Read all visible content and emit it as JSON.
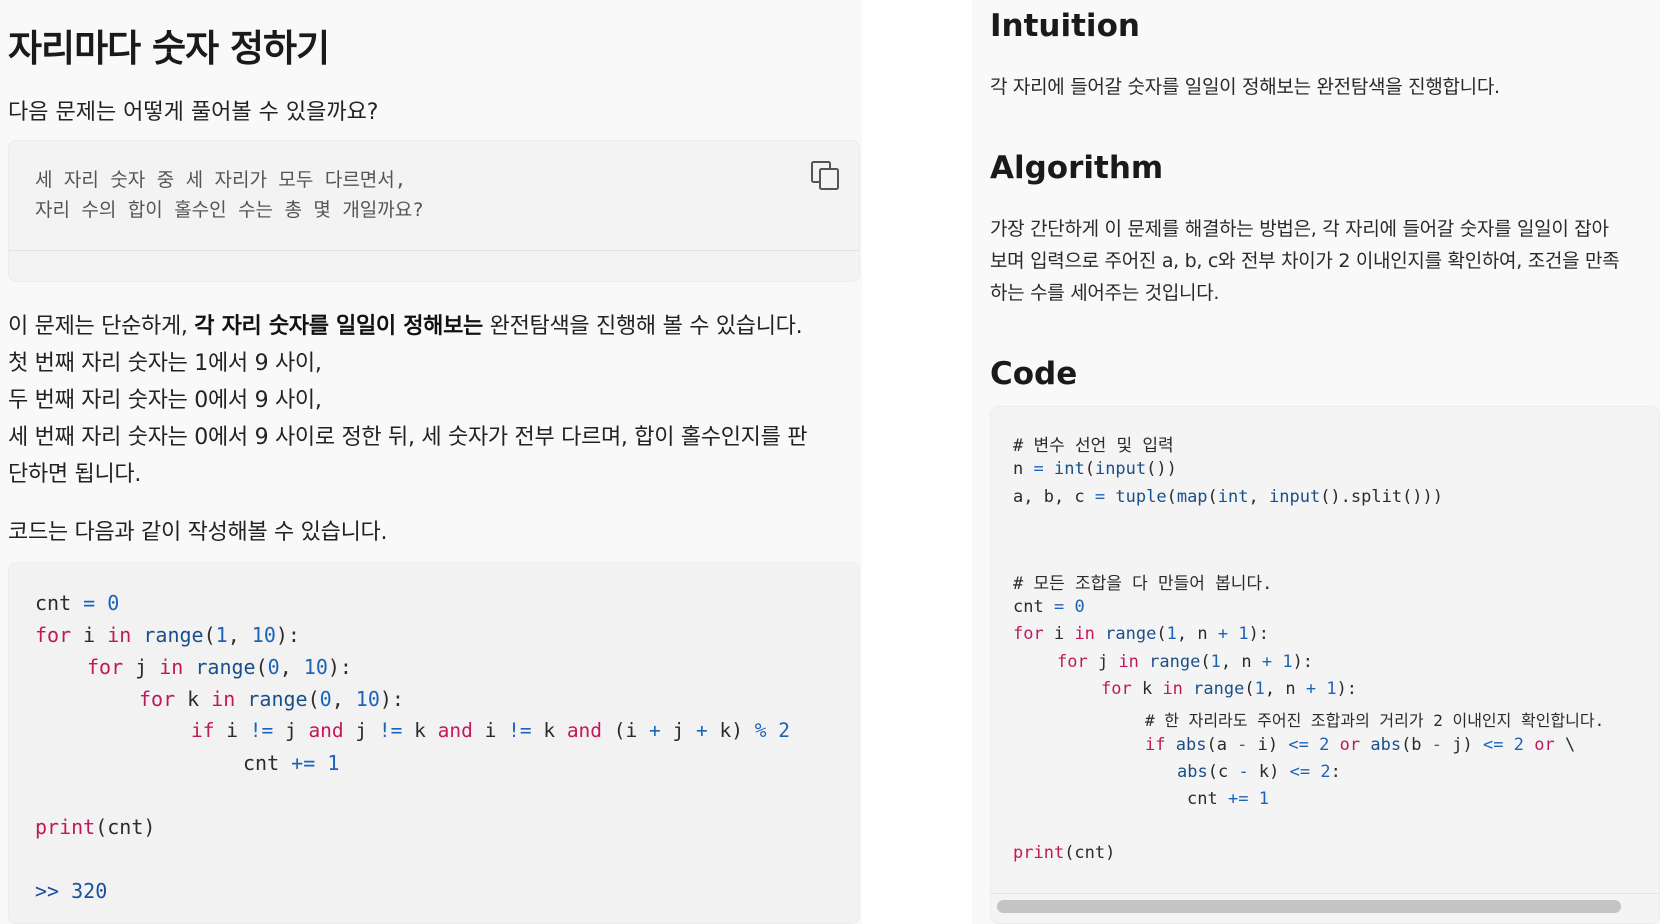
{
  "left": {
    "title": "자리마다 숫자 정하기",
    "question": "다음 문제는 어떻게 풀어볼 수 있을까요?",
    "quote_lines": [
      "세 자리 숫자 중 세 자리가 모두 다르면서,",
      "자리 수의 합이 홀수인 수는 총 몇 개일까요?"
    ],
    "copy_icon": "copy-icon",
    "explanation": {
      "line1_prefix": "이 문제는 단순하게, ",
      "line1_bold": "각 자리 숫자를 일일이 정해보는",
      "line1_suffix": " 완전탐색을 진행해 볼 수 있습니다.",
      "line2": "첫 번째 자리 숫자는 1에서 9 사이,",
      "line3": "두 번째 자리 숫자는 0에서 9 사이,",
      "line4": "세 번째 자리 숫자는 0에서 9 사이로 정한 뒤, 세 숫자가 전부 다르며, 합이 홀수인지를 판",
      "line5": "단하면 됩니다."
    },
    "code_intro": "코드는 다음과 같이 작성해볼 수 있습니다.",
    "code": {
      "l1": {
        "a": "cnt",
        "b": " = ",
        "c": "0"
      },
      "l2": {
        "a": "for",
        "b": " i ",
        "c": "in",
        "d": " ",
        "e": "range",
        "f": "(",
        "g": "1",
        "h": ", ",
        "i": "10",
        "j": "):"
      },
      "l3": {
        "a": "for",
        "b": " j ",
        "c": "in",
        "d": " ",
        "e": "range",
        "f": "(",
        "g": "0",
        "h": ", ",
        "i": "10",
        "j": "):"
      },
      "l4": {
        "a": "for",
        "b": " k ",
        "c": "in",
        "d": " ",
        "e": "range",
        "f": "(",
        "g": "0",
        "h": ", ",
        "i": "10",
        "j": "):"
      },
      "l5": {
        "a": "if",
        "b": " i ",
        "c": "!=",
        "d": " j ",
        "e": "and",
        "f": " j ",
        "g": "!=",
        "h": " k ",
        "i": "and",
        "j": " i ",
        "k": "!=",
        "l": " k ",
        "m": "and",
        "n": " (i ",
        "o": "+",
        "p": " j ",
        "q": "+",
        "r": " k) ",
        "s": "%",
        "t": " ",
        "u": "2"
      },
      "l6": {
        "a": "cnt ",
        "b": "+=",
        "c": " ",
        "d": "1"
      },
      "l7": {
        "a": "print",
        "b": "(cnt)"
      },
      "output_prompt": ">>",
      "output_value": "320"
    }
  },
  "right": {
    "intuition_heading": "Intuition",
    "intuition_text": "각 자리에 들어갈 숫자를 일일이 정해보는 완전탐색을 진행합니다.",
    "algorithm_heading": "Algorithm",
    "algorithm_lines": [
      "가장 간단하게 이 문제를 해결하는 방법은, 각 자리에 들어갈 숫자를 일일이 잡아",
      "보며 입력으로 주어진 a, b, c와 전부 차이가 2 이내인지를 확인하여, 조건을 만족",
      "하는 수를 세어주는 것입니다."
    ],
    "code_heading": "Code",
    "code": {
      "c1": "# 변수 선언 및 입력",
      "l2": {
        "a": "n ",
        "b": "=",
        "c": " ",
        "d": "int",
        "e": "(",
        "f": "input",
        "g": "())"
      },
      "l3": {
        "a": "a, b, c ",
        "b": "=",
        "c": " ",
        "d": "tuple",
        "e": "(",
        "f": "map",
        "g": "(",
        "h": "int",
        "i": ", ",
        "j": "input",
        "k": "().split()))"
      },
      "c2": "# 모든 조합을 다 만들어 봅니다.",
      "l5": {
        "a": "cnt ",
        "b": "=",
        "c": " ",
        "d": "0"
      },
      "l6": {
        "a": "for",
        "b": " i ",
        "c": "in",
        "d": " ",
        "e": "range",
        "f": "(",
        "g": "1",
        "h": ", n ",
        "i": "+",
        "j": " ",
        "k": "1",
        "l": "):"
      },
      "l7": {
        "a": "for",
        "b": " j ",
        "c": "in",
        "d": " ",
        "e": "range",
        "f": "(",
        "g": "1",
        "h": ", n ",
        "i": "+",
        "j": " ",
        "k": "1",
        "l": "):"
      },
      "l8": {
        "a": "for",
        "b": " k ",
        "c": "in",
        "d": " ",
        "e": "range",
        "f": "(",
        "g": "1",
        "h": ", n ",
        "i": "+",
        "j": " ",
        "k": "1",
        "l": "):"
      },
      "c3": "# 한 자리라도 주어진 조합과의 거리가 2 이내인지 확인합니다.",
      "l10": {
        "a": "if",
        "b": " ",
        "c": "abs",
        "d": "(a ",
        "e": "-",
        "f": " i) ",
        "g": "<=",
        "h": " ",
        "i": "2",
        "j": " ",
        "k": "or",
        "l": " ",
        "m": "abs",
        "n": "(b ",
        "o": "-",
        "p": " j) ",
        "q": "<=",
        "r": " ",
        "s": "2",
        "t": " ",
        "u": "or",
        "v": " \\"
      },
      "l11": {
        "a": "abs",
        "b": "(c ",
        "c": "-",
        "d": " k) ",
        "e": "<=",
        "f": " ",
        "g": "2",
        "h": ":"
      },
      "l12": {
        "a": "cnt ",
        "b": "+=",
        "c": " ",
        "d": "1"
      },
      "l13": {
        "a": "print",
        "b": "(cnt)"
      }
    }
  }
}
